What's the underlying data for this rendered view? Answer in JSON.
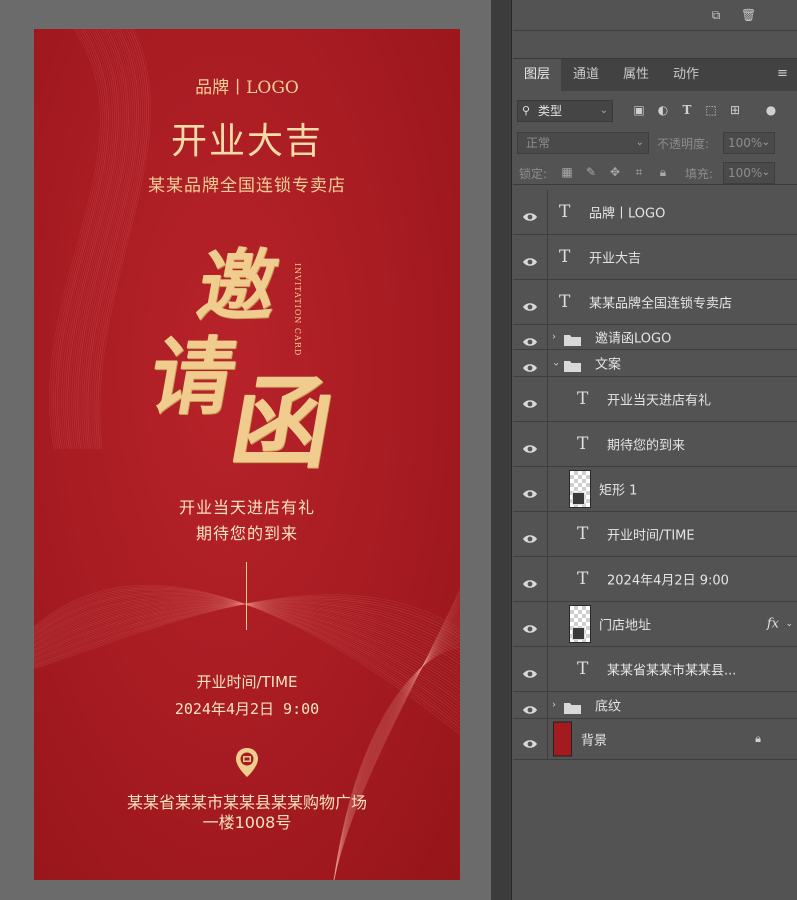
{
  "canvas": {
    "brand": "品牌丨LOGO",
    "title": "开业大吉",
    "subtitle": "某某品牌全国连锁专卖店",
    "calligraphy": [
      "邀",
      "请",
      "函"
    ],
    "invitation_en": "INVITATION CARD",
    "welcome_line1": "开业当天进店有礼",
    "welcome_line2": "期待您的到来",
    "time_label": "开业时间/TIME",
    "time_value": "2024年4月2日 9:00",
    "address_line1": "某某省某某市某某县某某购物广场",
    "address_line2": "一楼1008号",
    "colors": {
      "background": "#a61b21",
      "gold": "#f3d7a3"
    },
    "icons": {
      "location": "location-pin-icon"
    }
  },
  "panel": {
    "tabs": [
      {
        "label": "图层",
        "active": true
      },
      {
        "label": "通道",
        "active": false
      },
      {
        "label": "属性",
        "active": false
      },
      {
        "label": "动作",
        "active": false
      }
    ],
    "filter": {
      "label": "类型"
    },
    "blend_mode": "正常",
    "opacity_label": "不透明度:",
    "opacity_value": "100%",
    "lock_label": "锁定:",
    "fill_label": "填充:",
    "fill_value": "100%",
    "layers": [
      {
        "name": "品牌丨LOGO",
        "kind": "text",
        "indent": 0
      },
      {
        "name": "开业大吉",
        "kind": "text",
        "indent": 0
      },
      {
        "name": "某某品牌全国连锁专卖店",
        "kind": "text",
        "indent": 0
      },
      {
        "name": "邀请函LOGO",
        "kind": "group-collapsed",
        "indent": 0
      },
      {
        "name": "文案",
        "kind": "group-expanded",
        "indent": 0
      },
      {
        "name": "开业当天进店有礼",
        "kind": "text",
        "indent": 1
      },
      {
        "name": "期待您的到来",
        "kind": "text",
        "indent": 1
      },
      {
        "name": "矩形 1",
        "kind": "shape",
        "indent": 1
      },
      {
        "name": "开业时间/TIME",
        "kind": "text",
        "indent": 1
      },
      {
        "name": "2024年4月2日 9:00",
        "kind": "text",
        "indent": 1
      },
      {
        "name": "门店地址",
        "kind": "smart",
        "indent": 1,
        "fx": "fx"
      },
      {
        "name": "某某省某某市某某县...",
        "kind": "text",
        "indent": 1
      },
      {
        "name": "底纹",
        "kind": "group-collapsed",
        "indent": 0
      },
      {
        "name": "背景",
        "kind": "background",
        "indent": 0,
        "locked": true
      }
    ]
  }
}
